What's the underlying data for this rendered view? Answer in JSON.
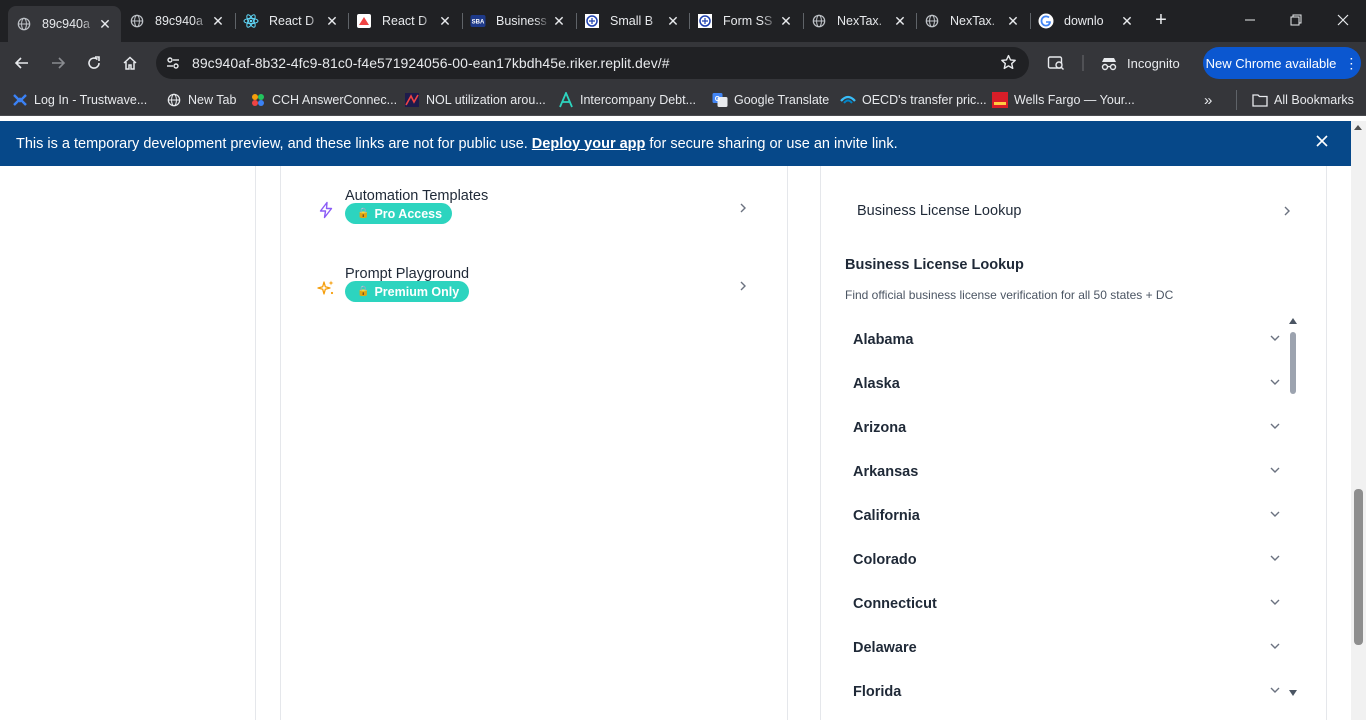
{
  "browser": {
    "tabs": [
      {
        "title": "89c940a",
        "icon": "globe-icon",
        "active": true
      },
      {
        "title": "89c940a",
        "icon": "globe-icon",
        "active": false
      },
      {
        "title": "React D",
        "icon": "react-icon",
        "active": false
      },
      {
        "title": "React D",
        "icon": "react-doc-icon",
        "active": false
      },
      {
        "title": "Business",
        "icon": "sba-icon",
        "active": false
      },
      {
        "title": "Small B",
        "icon": "irs-icon",
        "active": false
      },
      {
        "title": "Form SS",
        "icon": "irs-icon",
        "active": false
      },
      {
        "title": "NexTax.",
        "icon": "globe-icon",
        "active": false
      },
      {
        "title": "NexTax.",
        "icon": "globe-icon",
        "active": false
      },
      {
        "title": "downlo",
        "icon": "google-icon",
        "active": false
      }
    ],
    "new_tab_symbol": "+",
    "url": "89c940af-8b32-4fc9-81c0-f4e571924056-00-ean17kbdh45e.riker.replit.dev/#",
    "incognito_label": "Incognito",
    "update_button_label": "New Chrome available",
    "bookmarks": [
      {
        "label": "Log In - Trustwave...",
        "icon": "trustwave-icon",
        "color": "#3b82f6"
      },
      {
        "label": "New Tab",
        "icon": "globe-icon",
        "color": "#e8eaed"
      },
      {
        "label": "CCH AnswerConnec...",
        "icon": "cch-icon",
        "color": "#f59e0b"
      },
      {
        "label": "NOL utilization arou...",
        "icon": "nol-icon",
        "color": "#ef4444"
      },
      {
        "label": "Intercompany Debt...",
        "icon": "letter-a-icon",
        "color": "#14b8a6"
      },
      {
        "label": "Google Translate",
        "icon": "translate-icon",
        "color": "#4285f4"
      },
      {
        "label": "OECD's transfer pric...",
        "icon": "oecd-icon",
        "color": "#38bdf8"
      },
      {
        "label": "Wells Fargo — Your...",
        "icon": "wellsfargo-icon",
        "color": "#d71e28"
      }
    ],
    "overflow_symbol": "»",
    "all_bookmarks_label": "All Bookmarks"
  },
  "banner": {
    "text_before": "This is a temporary development preview, and these links are not for public use.",
    "link_text": "Deploy your app",
    "text_after": "for secure sharing or use an invite link."
  },
  "left_panel": {
    "items": [
      {
        "name": "Automation Templates",
        "badge": "Pro Access",
        "icon": "lightning-icon",
        "icon_color": "#8b5cf6"
      },
      {
        "name": "Prompt Playground",
        "badge": "Premium Only",
        "icon": "sparkles-icon",
        "icon_color": "#f59e0b"
      }
    ],
    "badge_color": "#2dd4bf"
  },
  "right_panel": {
    "lookup_link": "Business License Lookup",
    "section_title": "Business License Lookup",
    "section_subtitle": "Find official business license verification for all 50 states + DC",
    "states": [
      "Alabama",
      "Alaska",
      "Arizona",
      "Arkansas",
      "California",
      "Colorado",
      "Connecticut",
      "Delaware",
      "Florida"
    ]
  }
}
